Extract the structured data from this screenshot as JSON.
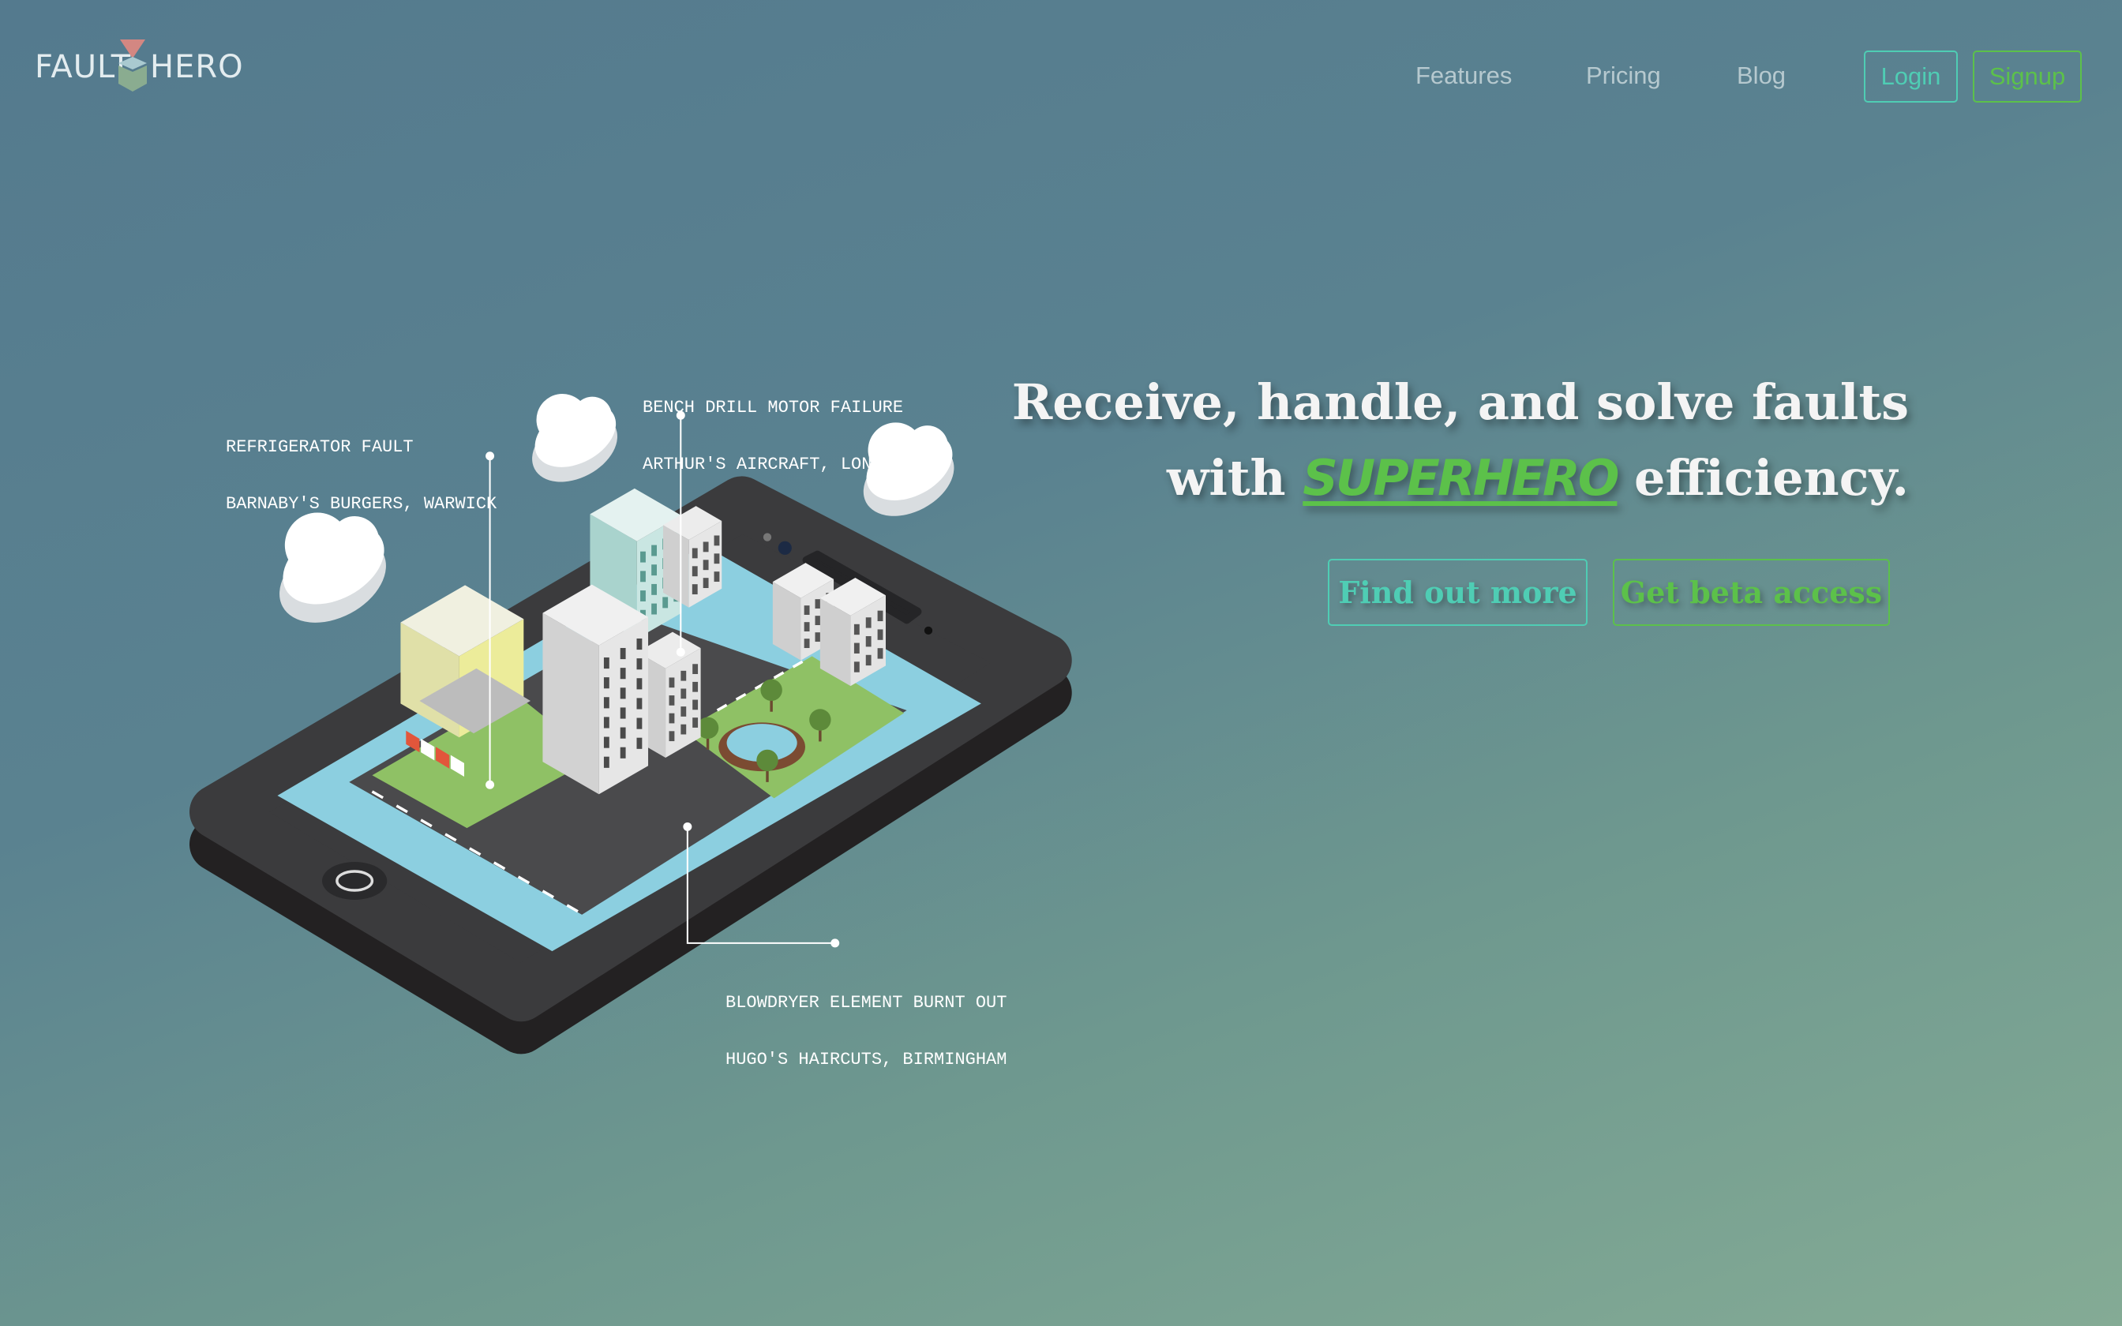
{
  "brand": {
    "left": "FAULT",
    "right": "HERO",
    "logo_icon": "cube-with-downward-triangle",
    "colors": {
      "triangle": "#d38782",
      "cube_top": "#a9c9d0",
      "cube_side": "#8aac90"
    }
  },
  "nav": {
    "links": [
      {
        "label": "Features"
      },
      {
        "label": "Pricing"
      },
      {
        "label": "Blog"
      }
    ],
    "login_label": "Login",
    "signup_label": "Signup"
  },
  "hero": {
    "line1": "Receive, handle, and solve faults",
    "line2_prefix": "with",
    "highlight": "SUPERHERO",
    "line2_suffix": "efficiency.",
    "cta_primary": "Find out more",
    "cta_secondary": "Get beta access"
  },
  "callouts": [
    {
      "title": "REFRIGERATOR FAULT",
      "location": "BARNABY'S BURGERS, WARWICK"
    },
    {
      "title": "BENCH DRILL MOTOR FAILURE",
      "location": "ARTHUR'S AIRCRAFT, LONDON"
    },
    {
      "title": "BLOWDRYER ELEMENT BURNT OUT",
      "location": "HUGO'S HAIRCUTS, BIRMINGHAM"
    }
  ],
  "colors": {
    "teal": "#4fcdb4",
    "green": "#5cc14a",
    "nav_text": "#b6c9cf",
    "headline": "#f4f4f4"
  }
}
